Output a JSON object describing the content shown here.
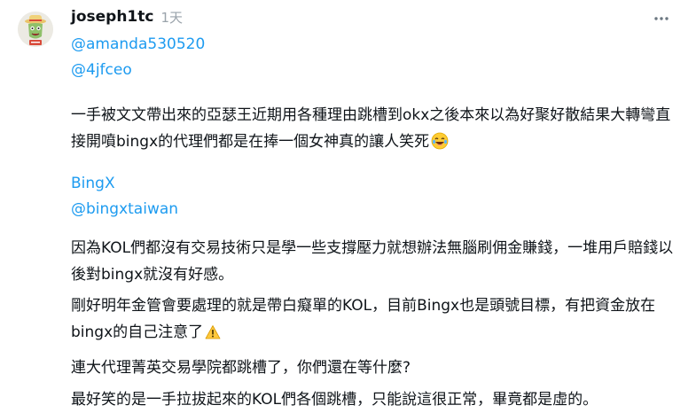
{
  "post": {
    "username": "joseph1tc",
    "time": "1天",
    "mentions_1": [
      "@amanda530520",
      "@4jfceo"
    ],
    "paragraph_1": "一手被文文帶出來的亞瑟王近期用各種理由跳槽到okx之後本來以為好聚好散結果大轉彎直接開噴bingx的代理們都是在捧一個女神真的讓人笑死",
    "paragraph_1_emoji": "laughing-tears-emoji",
    "mentions_2": [
      "BingX",
      "@bingxtaiwan"
    ],
    "paragraph_2": "因為KOL們都沒有交易技術只是學一些支撐壓力就想辦法無腦刷佣金賺錢，一堆用戶賠錢以後對bingx就沒有好感。",
    "paragraph_3": "剛好明年金管會要處理的就是帶白癡單的KOL，目前Bingx也是頭號目標，有把資金放在bingx的自己注意了",
    "paragraph_3_emoji": "warning-emoji",
    "paragraph_4": "連大代理菁英交易學院都跳槽了，你們還在等什麼?",
    "paragraph_5": "最好笑的是一手拉拔起來的KOL們各個跳槽，只能說這很正常，畢竟都是虛的。"
  },
  "colors": {
    "link": "#1d9bf0",
    "text": "#0f1419",
    "muted": "#9aa3ab"
  },
  "icons": {
    "more": "more-dots-icon",
    "avatar": "cartoon-face-avatar"
  }
}
